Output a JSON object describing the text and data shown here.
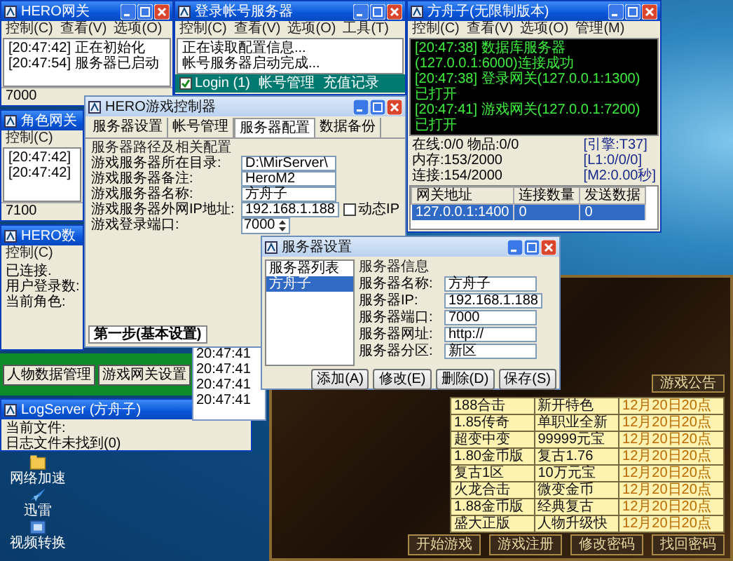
{
  "gateway_window": {
    "title": "HERO网关",
    "menu": [
      "控制(C)",
      "查看(V)",
      "选项(O)"
    ],
    "log": [
      "[20:47:42] 正在初始化",
      "[20:47:54] 服务器已启动"
    ],
    "status": "7000"
  },
  "login_window": {
    "title": "登录帐号服务器",
    "menu": [
      "控制(C)",
      "查看(V)",
      "选项(O)",
      "工具(T)"
    ],
    "log": [
      "正在读取配置信息...",
      "帐号服务器启动完成..."
    ],
    "toolbar": {
      "checkbox": {
        "label": "Login (1)",
        "checked": true
      },
      "buttons": [
        "帐号管理",
        "充值记录"
      ]
    }
  },
  "engine_window": {
    "title": "方舟子(无限制版本)",
    "menu": [
      "控制(C)",
      "查看(V)",
      "选项(O)",
      "管理(M)"
    ],
    "console": [
      "[20:47:38] 数据库服务器(127.0.0.1:6000)连接成功",
      "[20:47:38] 登录网关(127.0.0.1:1300)已打开",
      "[20:47:41] 游戏网关(127.0.0.1:7200)已打开"
    ],
    "stats_left": [
      "在线:0/0 物品:0/0",
      "内存:153/2000",
      "连接:154/2000"
    ],
    "stats_right": [
      "[引擎:T37]",
      "[L1:0/0/0]",
      "[M2:0.00秒]"
    ],
    "table": {
      "columns": [
        "网关地址",
        "连接数量",
        "发送数据"
      ],
      "rows": [
        {
          "cells": [
            "127.0.0.1:1400",
            "0",
            "0"
          ],
          "selected": true
        }
      ]
    }
  },
  "role_gateway_window": {
    "title": "角色网关",
    "menu": [
      "控制(C)"
    ],
    "log": [
      "[20:47:42]",
      "[20:47:42]"
    ],
    "status": "7100"
  },
  "database_window": {
    "title": "HERO数",
    "menu": [
      "控制(C)"
    ],
    "lines": [
      "已连接.",
      "用户登录数:",
      "当前角色:"
    ]
  },
  "launcher_bar": {
    "buttons": [
      "人物数据管理",
      "游戏网关设置"
    ]
  },
  "log_server_window": {
    "title": "LogServer (方舟子)",
    "lines": [
      "当前文件:",
      "日志文件未找到(0)"
    ]
  },
  "log_panel": {
    "lines": [
      "20:47:41",
      "20:47:41",
      "20:47:41",
      "20:47:41"
    ]
  },
  "controller_window": {
    "title": "HERO游戏控制器",
    "tabs": [
      {
        "label": "服务器设置",
        "selected": false
      },
      {
        "label": "帐号管理",
        "selected": false
      },
      {
        "label": "服务器配置",
        "selected": true
      },
      {
        "label": "数据备份",
        "selected": false
      }
    ],
    "group": "服务器路径及相关配置",
    "fields": [
      {
        "kind": "text",
        "label": "游戏服务器所在目录:",
        "value": "D:\\MirServer\\"
      },
      {
        "kind": "text",
        "label": "游戏服务器备注:",
        "value": "HeroM2"
      },
      {
        "kind": "text",
        "label": "游戏服务器名称:",
        "value": "方舟子"
      },
      {
        "kind": "text",
        "label": "游戏服务器外网IP地址:",
        "value": "192.168.1.188",
        "checkbox": {
          "label": "动态IP",
          "checked": false
        }
      },
      {
        "kind": "spin",
        "label": "游戏登录端口:",
        "value": "7000"
      }
    ],
    "step_tabs": [
      {
        "label": "第一步(基本设置)",
        "selected": true
      }
    ]
  },
  "server_dialog": {
    "title": "服务器设置",
    "list_title": "服务器列表",
    "servers": [
      {
        "label": "方舟子",
        "selected": true
      }
    ],
    "group": "服务器信息",
    "fields": [
      {
        "label": "服务器名称:",
        "value": "方舟子"
      },
      {
        "label": "服务器IP:",
        "value": "192.168.1.188"
      },
      {
        "label": "服务器端口:",
        "value": "7000"
      },
      {
        "label": "服务器网址:",
        "value": "http://"
      },
      {
        "label": "服务器分区:",
        "value": "新区"
      }
    ],
    "buttons": [
      "添加(A)",
      "修改(E)",
      "删除(D)",
      "保存(S)"
    ]
  },
  "game_panel": {
    "tab": "游戏公告",
    "rows": [
      [
        "188合击",
        "新开特色",
        "12月20日20点"
      ],
      [
        "1.85传奇",
        "单职业全新",
        "12月20日20点"
      ],
      [
        "超变中变",
        "99999元宝",
        "12月20日20点"
      ],
      [
        "1.80金币版",
        "复古1.76",
        "12月20日20点"
      ],
      [
        "复古1区",
        "10万元宝",
        "12月20日20点"
      ],
      [
        "火龙合击",
        "微变金币",
        "12月20日20点"
      ],
      [
        "1.88金币版",
        "经典复古",
        "12月20日20点"
      ],
      [
        "盛大正版",
        "人物升级快",
        "12月20日20点"
      ]
    ],
    "buttons": [
      "开始游戏",
      "游戏注册",
      "修改密码",
      "找回密码"
    ]
  },
  "desktop_icons": [
    {
      "label": "网络加速",
      "kind": "folder"
    },
    {
      "label": "迅雷",
      "kind": "bird"
    },
    {
      "label": "视频转换",
      "kind": "video"
    }
  ]
}
